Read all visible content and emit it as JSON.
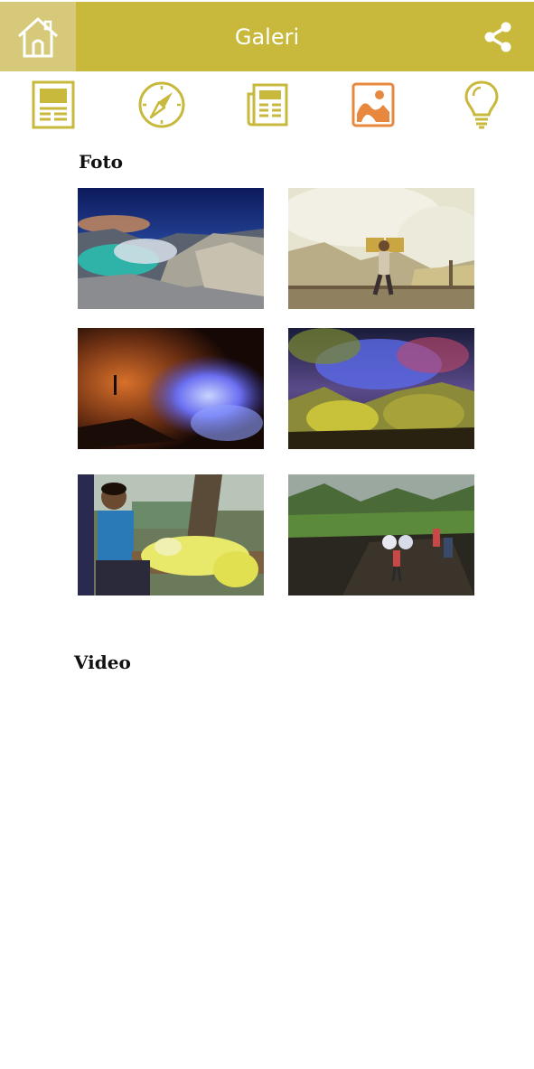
{
  "header": {
    "title": "Galeri",
    "colors": {
      "bar": "#c8b83b",
      "home_bg": "#d6c97a",
      "icon_inactive": "#c8b83b",
      "icon_active": "#e8883e"
    }
  },
  "nav": {
    "items": [
      {
        "icon": "article-icon",
        "active": false
      },
      {
        "icon": "compass-icon",
        "active": false
      },
      {
        "icon": "newspaper-icon",
        "active": false
      },
      {
        "icon": "gallery-icon",
        "active": true
      },
      {
        "icon": "lightbulb-icon",
        "active": false
      }
    ]
  },
  "photos": {
    "title": "Foto",
    "items": [
      {
        "icon": "crater-lake-photo"
      },
      {
        "icon": "sulfur-miner-photo"
      },
      {
        "icon": "blue-fire-cave-photo"
      },
      {
        "icon": "blue-fire-crater-photo"
      },
      {
        "icon": "boy-selling-sulfur-photo"
      },
      {
        "icon": "miners-forest-trail-photo"
      }
    ]
  },
  "videos": {
    "title": "Video"
  }
}
